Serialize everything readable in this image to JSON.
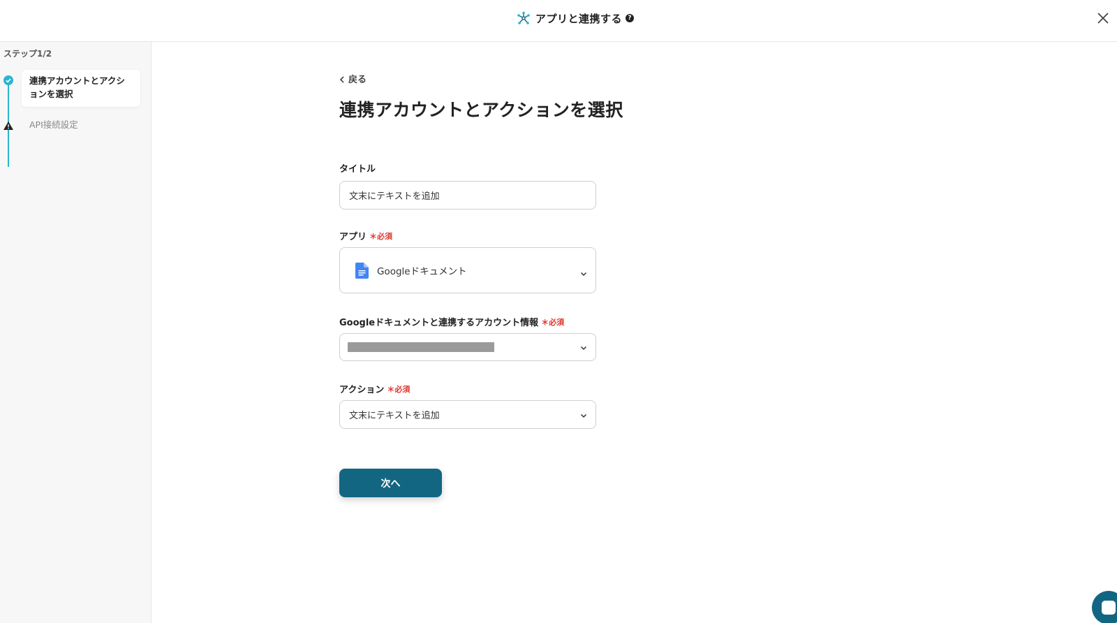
{
  "header": {
    "title": "アプリと連携する",
    "help_icon": "?",
    "icons": [
      "network-icon",
      "help-icon",
      "close-icon"
    ]
  },
  "sidebar": {
    "step_count": "ステップ1/2",
    "steps": [
      {
        "label": "連携アカウントとアクションを選択",
        "status": "complete"
      },
      {
        "label": "API接続設定",
        "status": "warning"
      }
    ]
  },
  "main": {
    "back_label": "戻る",
    "title": "連携アカウントとアクションを選択",
    "fields": {
      "title": {
        "label": "タイトル",
        "value": "文末にテキストを追加"
      },
      "app": {
        "label": "アプリ",
        "required": "＊必須",
        "value": "Googleドキュメント"
      },
      "account": {
        "label": "Googleドキュメントと連携するアカウント情報",
        "required": "＊必須"
      },
      "action": {
        "label": "アクション",
        "required": "＊必須",
        "value": "文末にテキストを追加"
      }
    },
    "next_label": "次へ"
  },
  "colors": {
    "accent": "#2bb5d0",
    "primary_button": "#136682",
    "required": "#e0362e"
  }
}
